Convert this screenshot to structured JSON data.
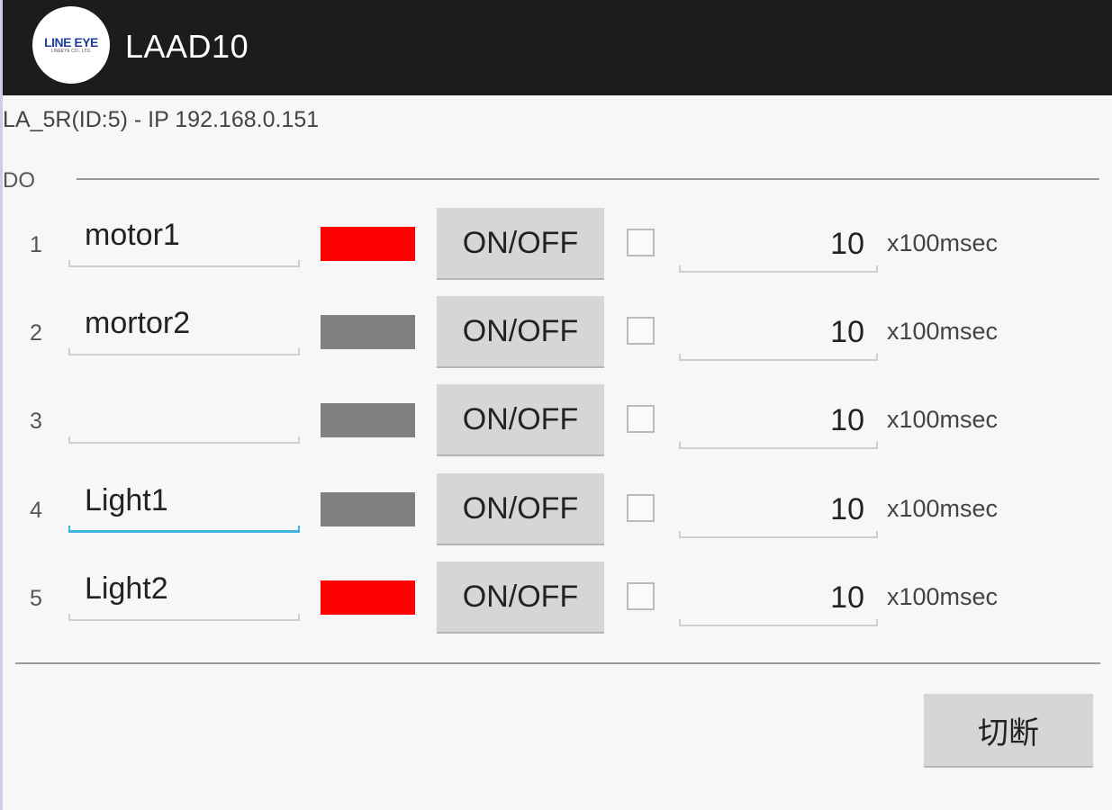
{
  "app": {
    "title": "LAAD10",
    "logo_text": "LINE EYE",
    "logo_subtext": "LINEEYE CO., LTD."
  },
  "device": {
    "info": "LA_5R(ID:5)  - IP  192.168.0.151"
  },
  "section": {
    "label": "DO"
  },
  "rows": [
    {
      "num": "1",
      "name": "motor1",
      "state": "on",
      "indicator_color": "#ff0000",
      "button": "ON/OFF",
      "checked": false,
      "time": "10",
      "unit": "x100msec"
    },
    {
      "num": "2",
      "name": "mortor2",
      "state": "off",
      "indicator_color": "#808080",
      "button": "ON/OFF",
      "checked": false,
      "time": "10",
      "unit": "x100msec"
    },
    {
      "num": "3",
      "name": "",
      "state": "off",
      "indicator_color": "#808080",
      "button": "ON/OFF",
      "checked": false,
      "time": "10",
      "unit": "x100msec"
    },
    {
      "num": "4",
      "name": "Light1",
      "state": "off",
      "indicator_color": "#808080",
      "button": "ON/OFF",
      "checked": false,
      "time": "10",
      "unit": "x100msec",
      "focused": true
    },
    {
      "num": "5",
      "name": "Light2",
      "state": "on",
      "indicator_color": "#ff0000",
      "button": "ON/OFF",
      "checked": false,
      "time": "10",
      "unit": "x100msec"
    }
  ],
  "footer": {
    "disconnect_label": "切断"
  },
  "colors": {
    "on": "#ff0000",
    "off": "#808080",
    "focus": "#3eb4de",
    "titlebar": "#1c1c1c"
  }
}
